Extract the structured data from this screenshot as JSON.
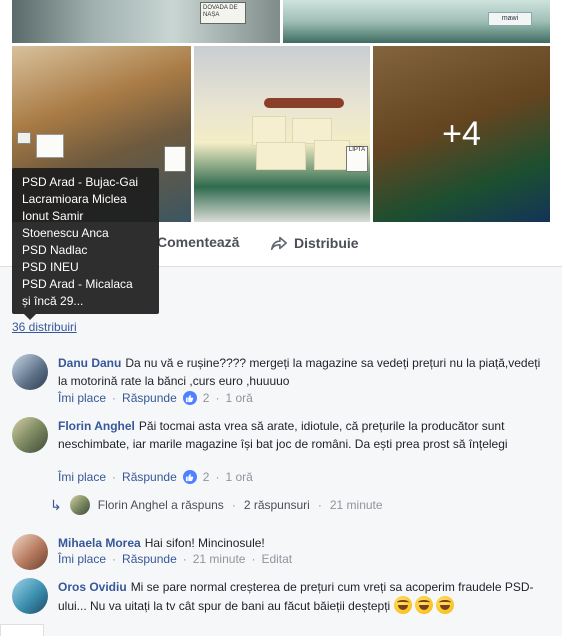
{
  "photos": {
    "more_count": "+4",
    "sign_text": "DOVADA DE NAȘA",
    "sign2_text": "mawi",
    "label_b": "LIPTA",
    "label_price": "4,6"
  },
  "actions": {
    "comment_label": "Comentează",
    "share_label": "Distribuie"
  },
  "tooltip": {
    "lines": [
      "PSD Arad - Bujac-Gai",
      "Lacramioara Miclea",
      "Ionut Samir",
      "Stoenescu Anca",
      "PSD Nadlac",
      "PSD INEU",
      "PSD Arad - Micalaca",
      "și încă 29..."
    ]
  },
  "shares": {
    "count_label": "36 distribuiri"
  },
  "comments": [
    {
      "name": "Danu Danu",
      "text": "Da nu vă e rușine???? mergeți la magazine sa vedeți prețuri nu la piață,vedeți la motorină rate la bănci ,curs euro ,huuuuo",
      "like": "Îmi place",
      "reply": "Răspunde",
      "reactions": "2",
      "time": "1 oră"
    },
    {
      "name": "Florin Anghel",
      "text": "Păi tocmai asta vrea să arate, idiotule, că prețurile la producător sunt neschimbate, iar marile magazine își bat joc de români. Da ești prea prost să înțelegi",
      "like": "Îmi place",
      "reply": "Răspunde",
      "reactions": "2",
      "time": "1 oră"
    },
    {
      "name": "Mihaela Morea",
      "text": "Hai sifon! Mincinosule!",
      "like": "Îmi place",
      "reply": "Răspunde",
      "time": "21 minute",
      "edited": "Editat"
    },
    {
      "name": "Oros Ovidiu",
      "text": "Mi se pare normal creșterea de prețuri cum vreți sa acoperim fraudele PSD-ului... Nu va uitați la tv cât spur de bani au făcut băieții deștepți"
    }
  ],
  "reply_summary": {
    "text": "Florin Anghel a răspuns",
    "count": "2 răspunsuri",
    "time": "21 minute"
  },
  "colors": {
    "link": "#365899",
    "meta": "#90949c",
    "panel": "#f6f7f9",
    "like_badge": "#4f80ff"
  }
}
